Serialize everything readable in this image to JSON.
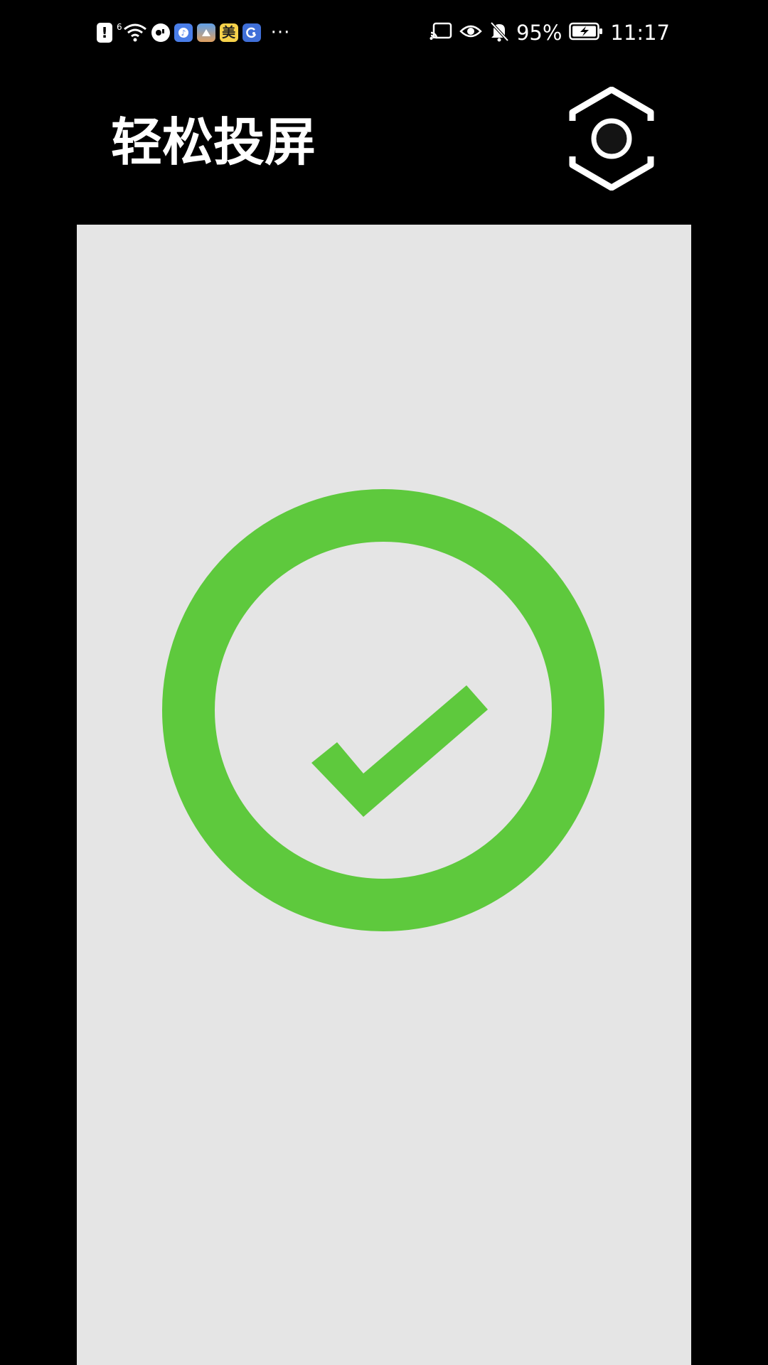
{
  "status_bar": {
    "notification_icons": [
      "alert-icon",
      "wifi-6-icon",
      "app-icon-1",
      "app-icon-2",
      "app-icon-3",
      "meituan-icon",
      "app-icon-4"
    ],
    "meituan_label": "美",
    "wifi_label": "6",
    "more": "···",
    "battery_percent": "95%",
    "time": "11:17"
  },
  "header": {
    "title": "轻松投屏"
  },
  "status": {
    "icon": "success-check-icon",
    "accent_color": "#5ec93d",
    "panel_color": "#e5e5e5"
  }
}
